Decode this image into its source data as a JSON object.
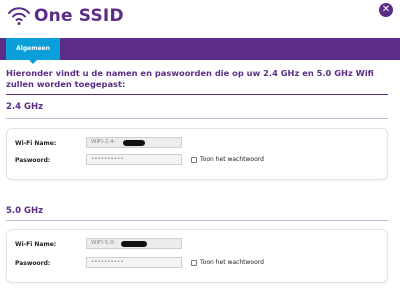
{
  "header": {
    "title": "One SSID",
    "logo_icon": "wifi-signal-icon",
    "close_icon": "close-icon",
    "close_symbol": "✕",
    "brand_color": "#5b2d86"
  },
  "tabs": [
    {
      "label": "Algemeen",
      "active": true,
      "color": "#0a9fd8"
    }
  ],
  "intro": {
    "text": "Hieronder vindt u de namen en paswoorden die op uw 2.4 GHz en 5.0 GHz Wifi zullen worden toegepast:"
  },
  "sections": [
    {
      "title": "2.4 GHz",
      "wifi_name_label": "Wi-Fi Name:",
      "wifi_name_value": "WIFI-2.4-",
      "password_label": "Paswoord:",
      "password_value": "••••••••••",
      "show_password_label": "Toon het wachtwoord",
      "show_password_checked": false
    },
    {
      "title": "5.0 GHz",
      "wifi_name_label": "Wi-Fi Name:",
      "wifi_name_value": "WIFI-5.0-",
      "password_label": "Paswoord:",
      "password_value": "••••••••••",
      "show_password_label": "Toon het wachtwoord",
      "show_password_checked": false
    }
  ]
}
